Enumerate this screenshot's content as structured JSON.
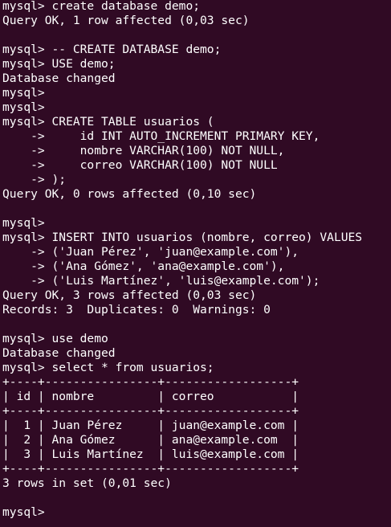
{
  "terminal": {
    "background": "#300a24",
    "foreground": "#ffffff",
    "lines": [
      "mysql> create database demo;",
      "Query OK, 1 row affected (0,03 sec)",
      "",
      "mysql> -- CREATE DATABASE demo;",
      "mysql> USE demo;",
      "Database changed",
      "mysql>",
      "mysql>",
      "mysql> CREATE TABLE usuarios (",
      "    ->     id INT AUTO_INCREMENT PRIMARY KEY,",
      "    ->     nombre VARCHAR(100) NOT NULL,",
      "    ->     correo VARCHAR(100) NOT NULL",
      "    -> );",
      "Query OK, 0 rows affected (0,10 sec)",
      "",
      "mysql>",
      "mysql> INSERT INTO usuarios (nombre, correo) VALUES",
      "    -> ('Juan Pérez', 'juan@example.com'),",
      "    -> ('Ana Gómez', 'ana@example.com'),",
      "    -> ('Luis Martínez', 'luis@example.com');",
      "Query OK, 3 rows affected (0,03 sec)",
      "Records: 3  Duplicates: 0  Warnings: 0",
      "",
      "mysql> use demo",
      "Database changed",
      "mysql> select * from usuarios;",
      "+----+----------------+------------------+",
      "| id | nombre         | correo           |",
      "+----+----------------+------------------+",
      "|  1 | Juan Pérez     | juan@example.com |",
      "|  2 | Ana Gómez      | ana@example.com  |",
      "|  3 | Luis Martínez  | luis@example.com |",
      "+----+----------------+------------------+",
      "3 rows in set (0,01 sec)",
      "",
      "mysql>"
    ]
  }
}
